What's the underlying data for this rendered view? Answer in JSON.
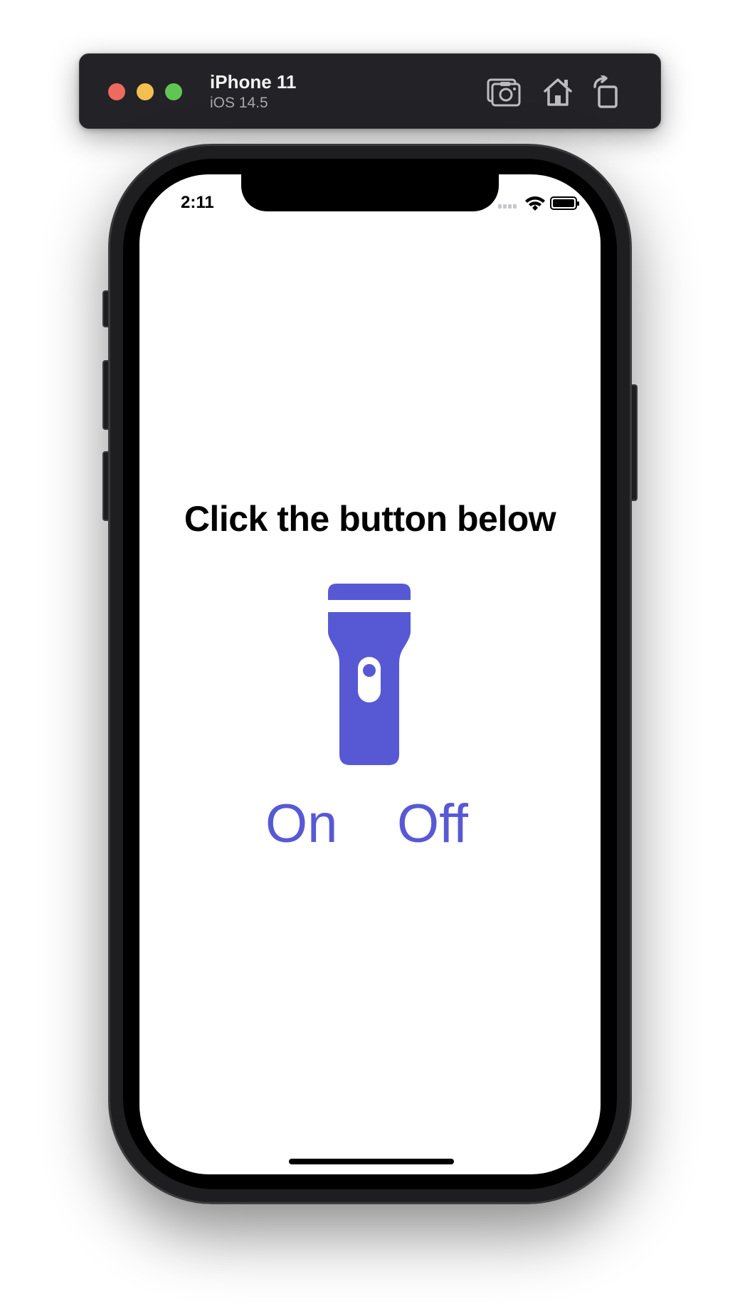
{
  "simulator": {
    "device_name": "iPhone 11",
    "os_version": "iOS 14.5",
    "toolbar": {
      "screenshot_icon": "camera-screenshot-icon",
      "home_icon": "home-icon",
      "rotate_icon": "rotate-icon"
    },
    "traffic_lights": {
      "close_color": "#ee6a5e",
      "minimize_color": "#f5bf4f",
      "zoom_color": "#61c554"
    }
  },
  "status_bar": {
    "time": "2:11",
    "icons": [
      "cellular-signal-icon",
      "wifi-icon",
      "battery-icon"
    ]
  },
  "main": {
    "headline": "Click the button below",
    "flashlight_icon": "flashlight-icon",
    "buttons": {
      "on_label": "On",
      "off_label": "Off"
    },
    "accent_color": "#5759d4"
  }
}
